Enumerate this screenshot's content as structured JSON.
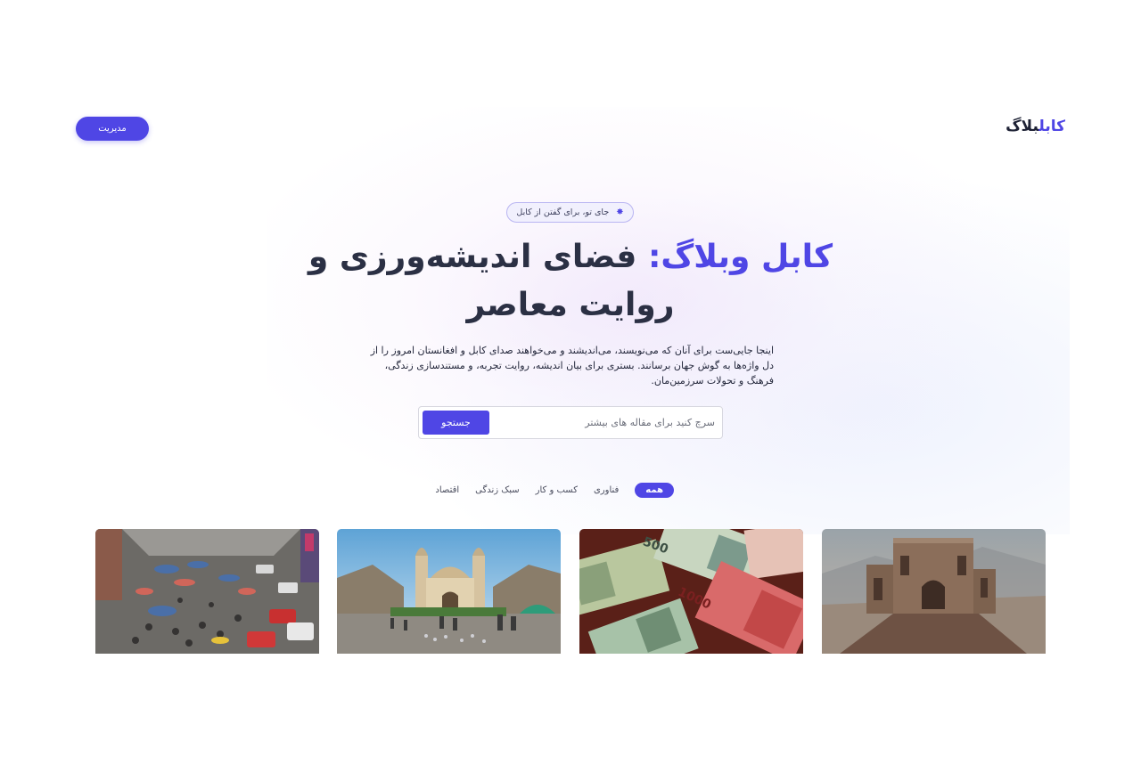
{
  "header": {
    "logo_part1": "کابل",
    "logo_part2": "بلاگ",
    "admin_label": "مدیریت"
  },
  "hero": {
    "tagline": "جای تو، برای گفتن از کابل",
    "title_accent": "کابل وبلاگ:",
    "title_rest": "فضای اندیشه‌ورزی و روایت معاصر",
    "description": "اینجا جایی‌ست برای آنان که می‌نویسند، می‌اندیشند و می‌خواهند صدای کابل و افغانستان امروز را از دل واژه‌ها به گوش جهان برسانند. بستری برای بیان اندیشه، روایت تجربه، و مستندسازی زندگی، فرهنگ و تحولات سرزمین‌مان."
  },
  "search": {
    "placeholder": "سرچ کنید برای مقاله های بیشتر",
    "button_label": "جستجو"
  },
  "categories": [
    {
      "label": "همه",
      "active": true
    },
    {
      "label": "فناوری",
      "active": false
    },
    {
      "label": "کسب و کار",
      "active": false
    },
    {
      "label": "سبک زندگی",
      "active": false
    },
    {
      "label": "اقتصاد",
      "active": false
    }
  ],
  "colors": {
    "accent": "#4f46e5",
    "heading": "#2b3044"
  },
  "cards": [
    {
      "image": "historic-ruins-photo"
    },
    {
      "image": "banknotes-photo"
    },
    {
      "image": "mosque-photo"
    },
    {
      "image": "crowded-market-photo"
    }
  ]
}
